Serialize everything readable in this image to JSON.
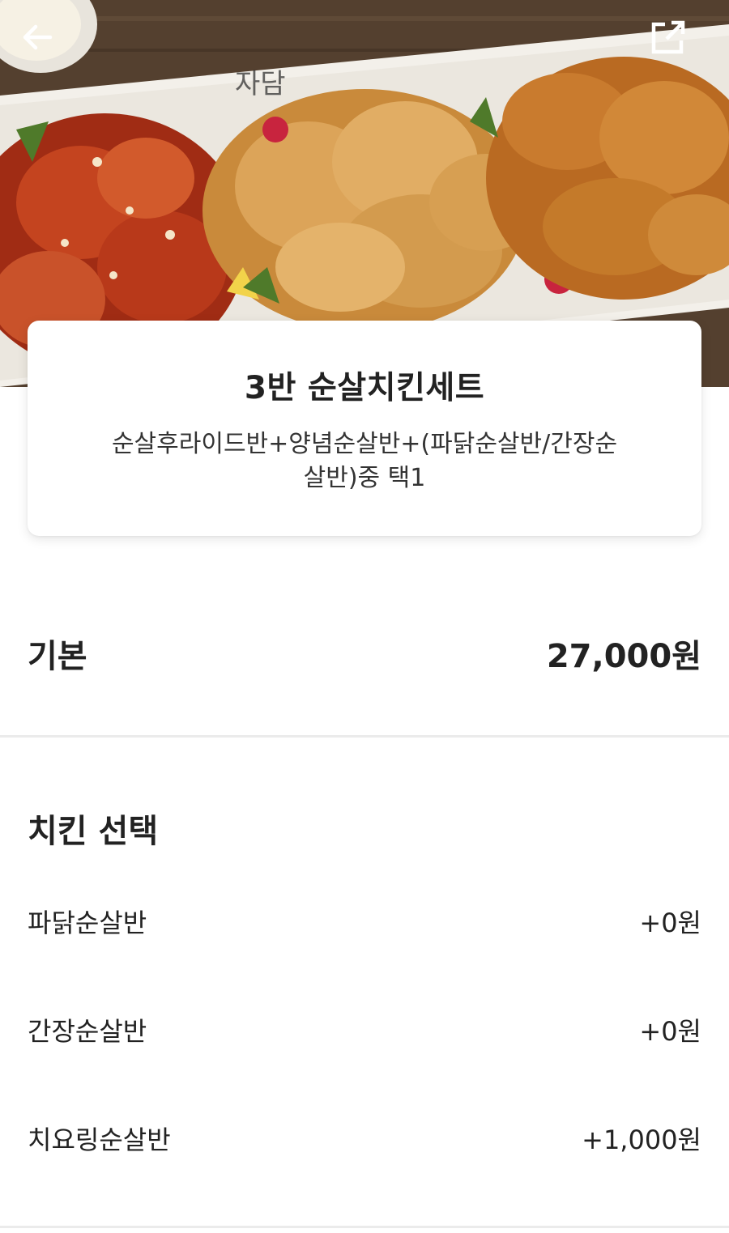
{
  "hero": {
    "icons": {
      "back": "arrow-left-icon",
      "share": "external-share-icon"
    },
    "colors": {
      "sauce": "#b5381b",
      "fried": "#d49a4a",
      "honey": "#c47a2a",
      "plate": "#f3f0ea"
    }
  },
  "menu": {
    "title": "3반 순살치킨세트",
    "description": "순살후라이드반+양념순살반+(파닭순살반/간장순살반)중 택1"
  },
  "base": {
    "label": "기본",
    "price": "27,000원"
  },
  "options": {
    "title": "치킨 선택",
    "items": [
      {
        "name": "파닭순살반",
        "price": "+0원"
      },
      {
        "name": "간장순살반",
        "price": "+0원"
      },
      {
        "name": "치요링순살반",
        "price": "+1,000원"
      }
    ]
  }
}
